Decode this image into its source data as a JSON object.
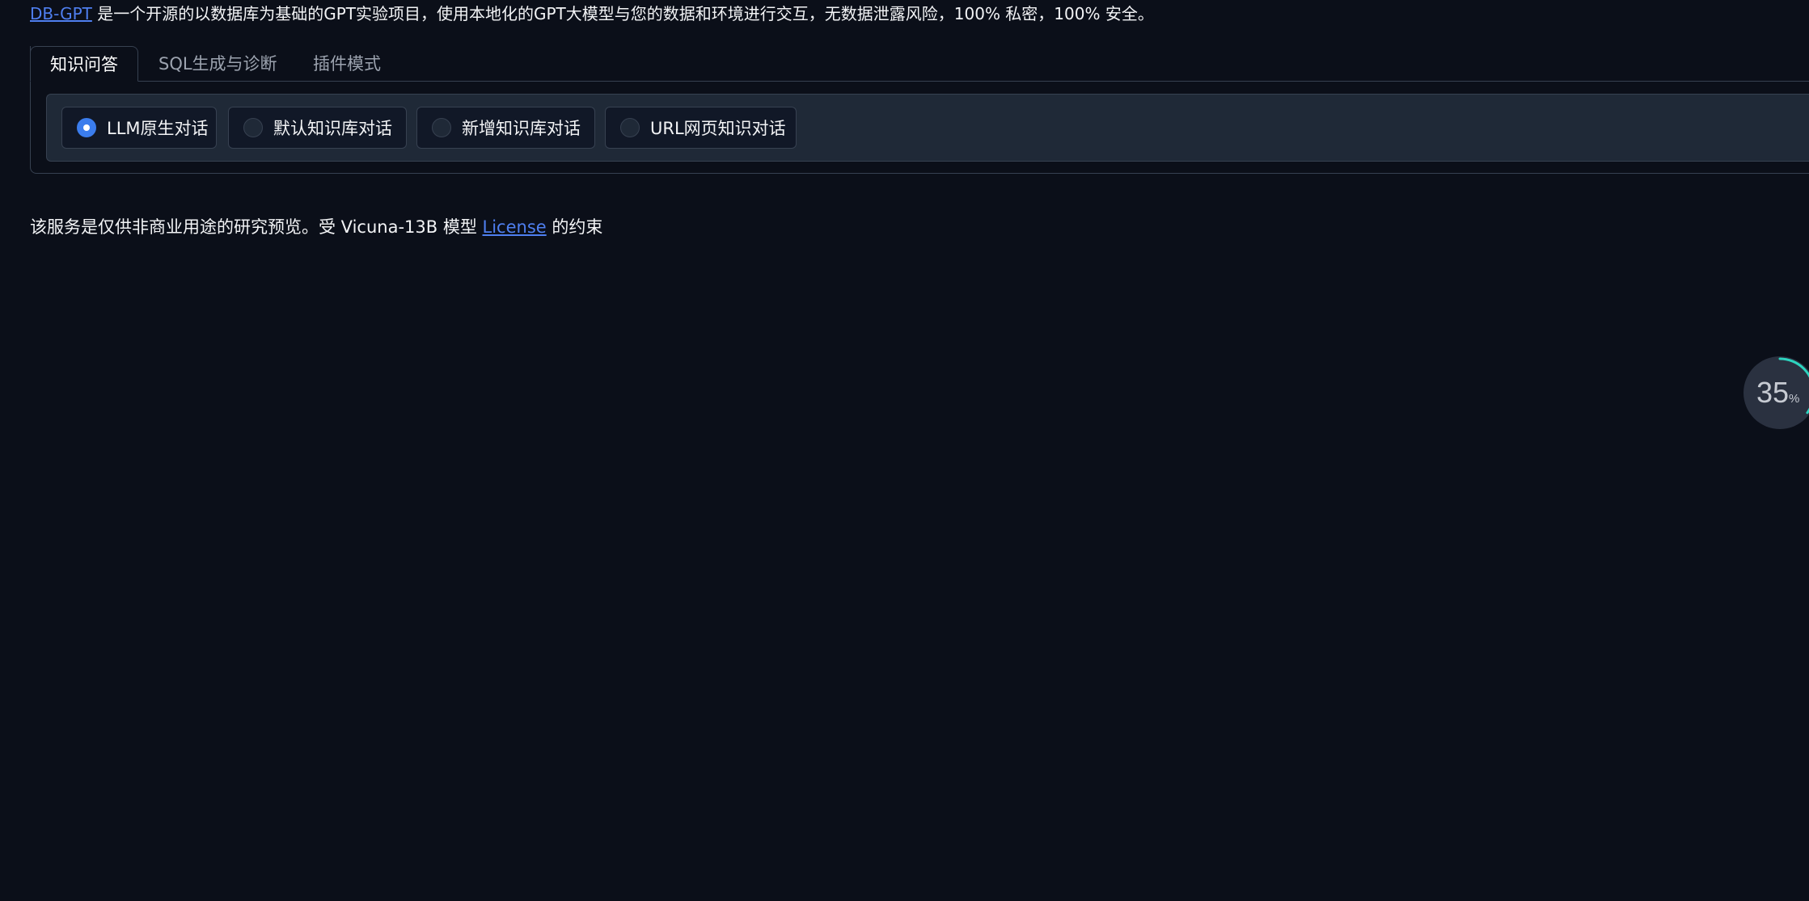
{
  "intro": {
    "link_text": "DB-GPT",
    "text": " 是一个开源的以数据库为基础的GPT实验项目，使用本地化的GPT大模型与您的数据和环境进行交互，无数据泄露风险，100% 私密，100% 安全。"
  },
  "tabs": [
    {
      "label": "知识问答",
      "active": true
    },
    {
      "label": "SQL生成与诊断",
      "active": false
    },
    {
      "label": "插件模式",
      "active": false
    }
  ],
  "radio_options": [
    {
      "label": "LLM原生对话",
      "checked": true
    },
    {
      "label": "默认知识库对话",
      "checked": false
    },
    {
      "label": "新增知识库对话",
      "checked": false
    },
    {
      "label": "URL网页知识对话",
      "checked": false
    }
  ],
  "footer": {
    "text_before": "该服务是仅供非商业用途的研究预览。受 Vicuna-13B 模型 ",
    "link_text": "License",
    "text_after": " 的约束"
  },
  "progress": {
    "value": "35",
    "unit": "%",
    "fraction": 0.35
  },
  "colors": {
    "background": "#0b0f19",
    "link": "#4f7ff0",
    "accent": "#3b7ded",
    "progress_ring": "#2dd4bf"
  }
}
